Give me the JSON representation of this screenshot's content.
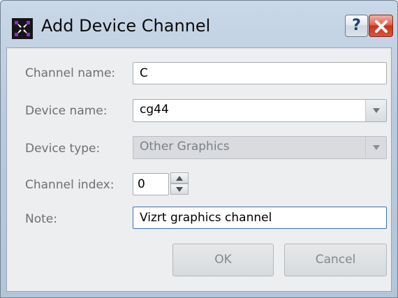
{
  "window": {
    "title": "Add Device Channel",
    "help_glyph": "?",
    "icon": "app-logo-icon"
  },
  "form": {
    "channel_name_label": "Channel name:",
    "channel_name_value": "C",
    "device_name_label": "Device name:",
    "device_name_value": "cg44",
    "device_type_label": "Device type:",
    "device_type_value": "Other Graphics",
    "channel_index_label": "Channel index:",
    "channel_index_value": "0",
    "note_label": "Note:",
    "note_value": "Vizrt graphics channel"
  },
  "buttons": {
    "ok": "OK",
    "cancel": "Cancel"
  },
  "colors": {
    "title_bar": "#c5d5e6",
    "close_button": "#d9543b",
    "disabled_text": "#85888c"
  }
}
